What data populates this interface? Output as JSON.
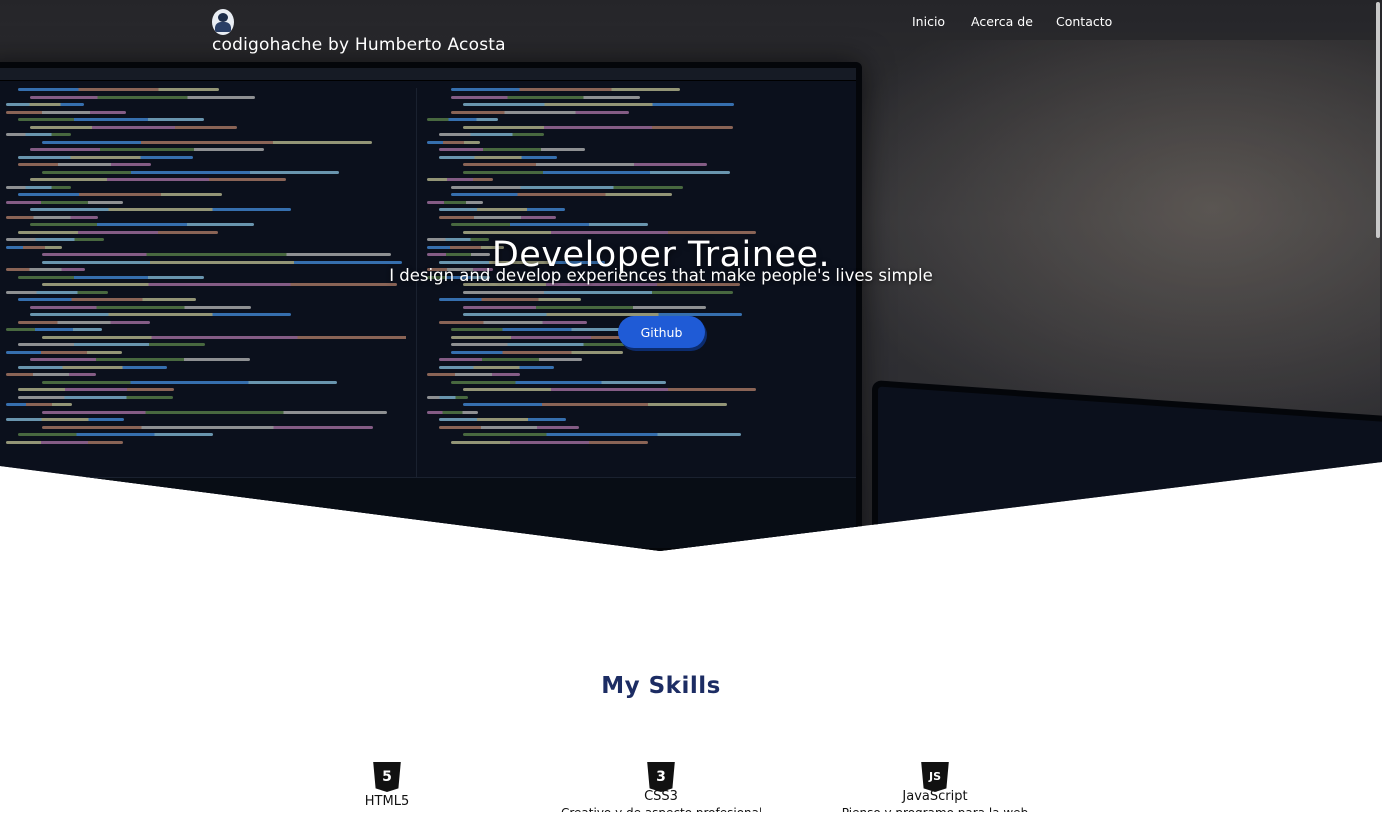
{
  "header": {
    "brand": "codigohache by Humberto Acosta",
    "logo_icon": "avatar-logo-icon",
    "nav": [
      {
        "label": "Inicio"
      },
      {
        "label": "Acerca de"
      },
      {
        "label": "Contacto"
      }
    ]
  },
  "hero": {
    "title": "Developer Trainee.",
    "subtitle": "I design and develop experiences that make people's lives simple",
    "button_label": "Github",
    "button_color": "#1f5bd6"
  },
  "skills": {
    "title": "My Skills",
    "title_color": "#1c2c63",
    "items": [
      {
        "icon": "html5-icon",
        "glyph": "5",
        "name": "HTML5",
        "desc": ""
      },
      {
        "icon": "css3-icon",
        "glyph": "3",
        "name": "CSS3",
        "desc": "Creativo y de aspecto profesional"
      },
      {
        "icon": "javascript-icon",
        "glyph": "JS",
        "name": "JavaScript",
        "desc": "Pienso y programo para la web"
      }
    ]
  }
}
